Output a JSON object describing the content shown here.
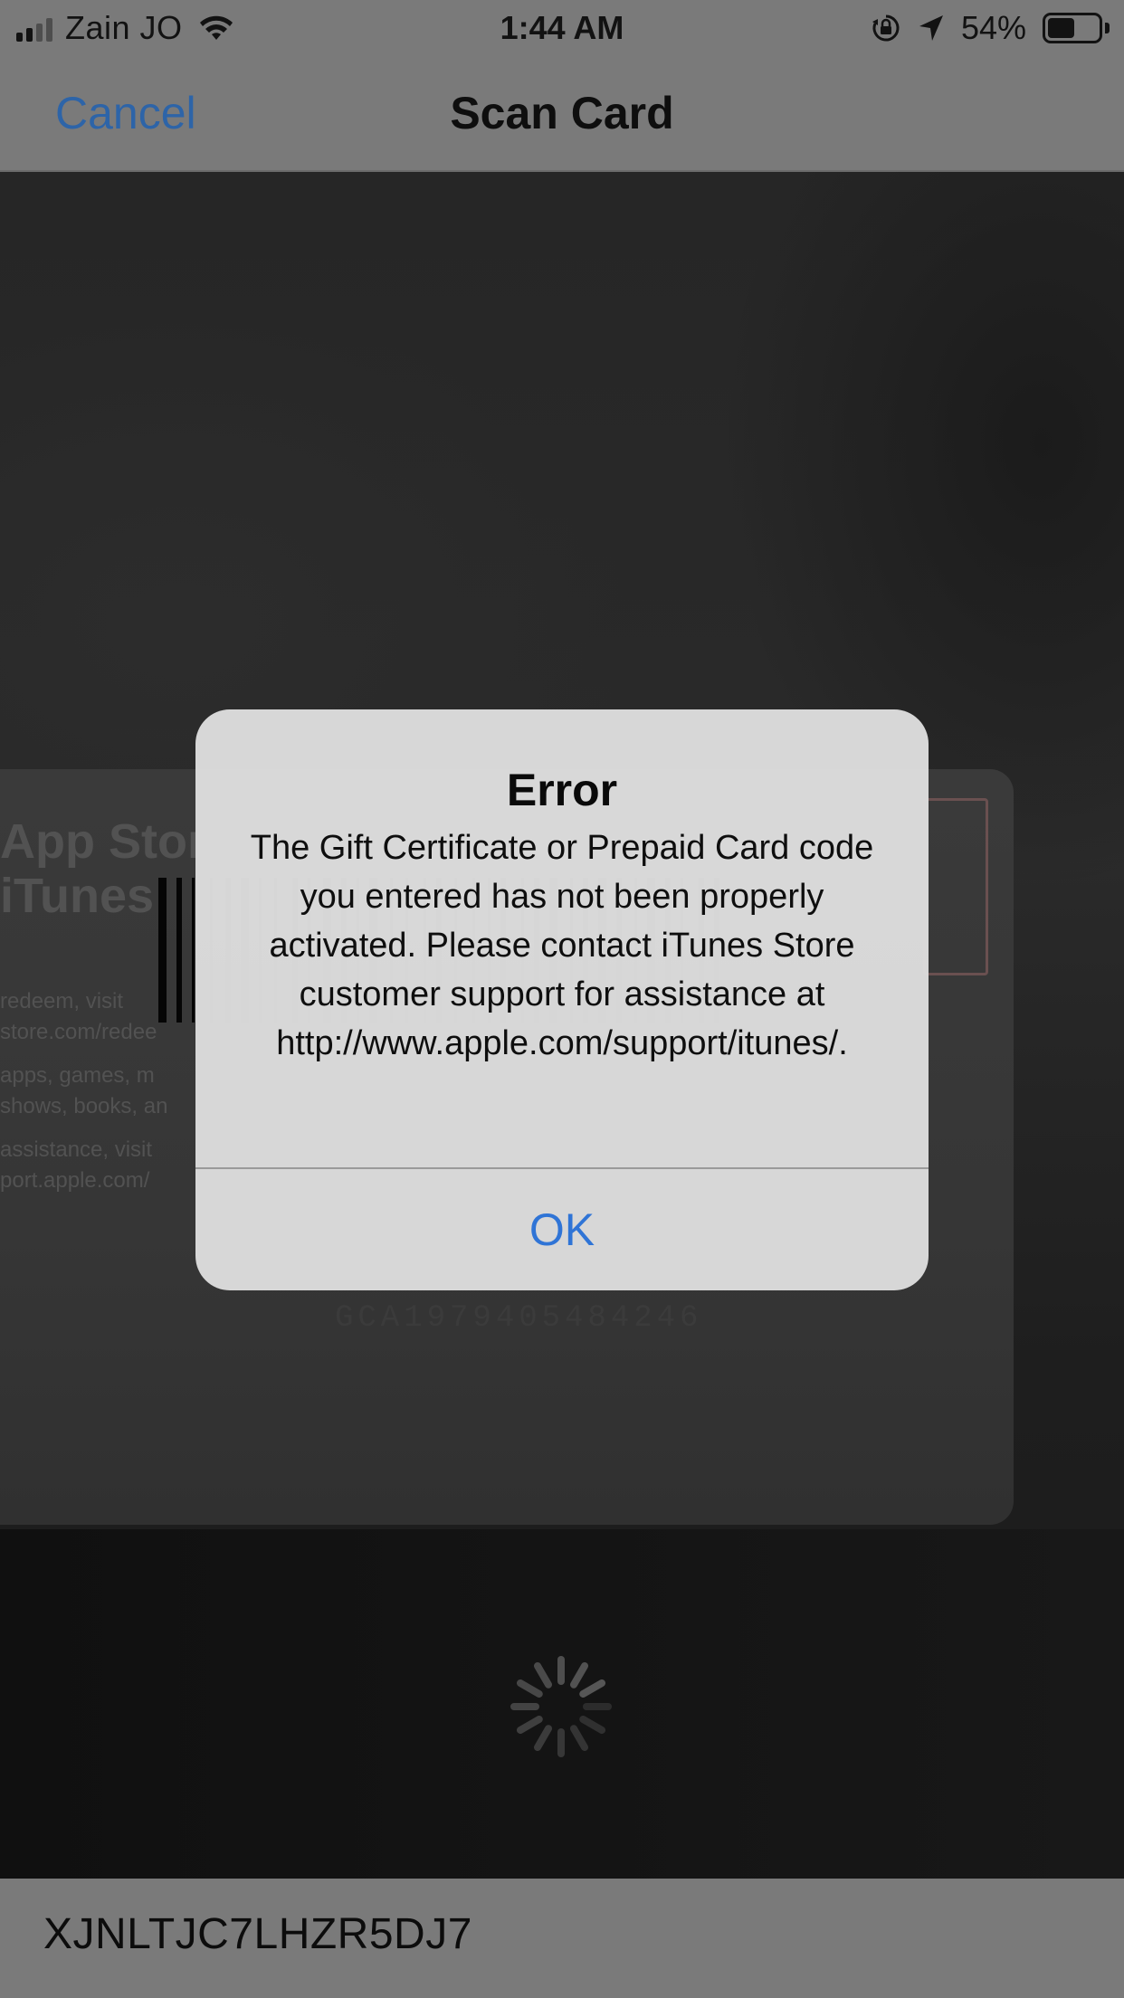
{
  "status_bar": {
    "carrier": "Zain JO",
    "time": "1:44 AM",
    "battery_percent": "54%",
    "battery_level": 0.54,
    "signal_bars": 2,
    "icons": [
      "signal-icon",
      "wifi-icon",
      "orientation-lock-icon",
      "location-arrow-icon",
      "battery-icon"
    ]
  },
  "nav": {
    "cancel_label": "Cancel",
    "title": "Scan Card"
  },
  "camera": {
    "card_brand_line1": "App Store",
    "card_brand_line2": "iTunes",
    "card_small_lines": [
      "redeem, visit",
      "store.com/redee",
      "apps, games, m",
      "shows, books, an",
      "assistance, visit",
      "port.apple.com/"
    ],
    "serial_number": "GCA1979405484246",
    "spinner_icon": "activity-spinner-icon"
  },
  "alert": {
    "title": "Error",
    "message": "The Gift Certificate or Prepaid Card code you entered has not been properly activated. Please contact iTunes Store customer support for assistance at http://www.apple.com/support/itunes/.",
    "ok_label": "OK"
  },
  "code_field": {
    "value": "XJNLTJC7LHZR5DJ7"
  },
  "colors": {
    "accent": "#2f74d6",
    "nav_link": "#2d64a8",
    "bar_background": "#7a7a7a",
    "alert_background": "#dddddd"
  }
}
